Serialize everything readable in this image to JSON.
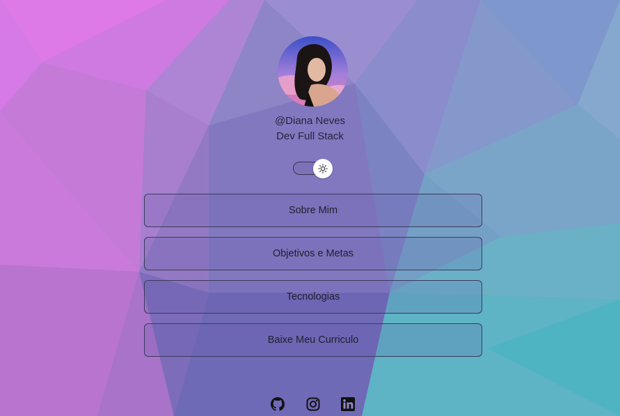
{
  "profile": {
    "handle": "@Diana Neves",
    "role": "Dev Full Stack",
    "avatar_icon": "avatar-photo"
  },
  "theme_toggle": {
    "icon": "sun-icon",
    "state": "light"
  },
  "links": [
    {
      "label": "Sobre Mim"
    },
    {
      "label": "Objetivos e Metas"
    },
    {
      "label": "Tecnologias"
    },
    {
      "label": "Baixe Meu Curriculo"
    }
  ],
  "social": [
    {
      "icon": "github-icon"
    },
    {
      "icon": "instagram-icon"
    },
    {
      "icon": "linkedin-icon"
    }
  ],
  "colors": {
    "bg_pink": "#d978e6",
    "bg_purple": "#8a7fc4",
    "bg_teal": "#5fb6c8",
    "text": "#1f1f2b"
  }
}
